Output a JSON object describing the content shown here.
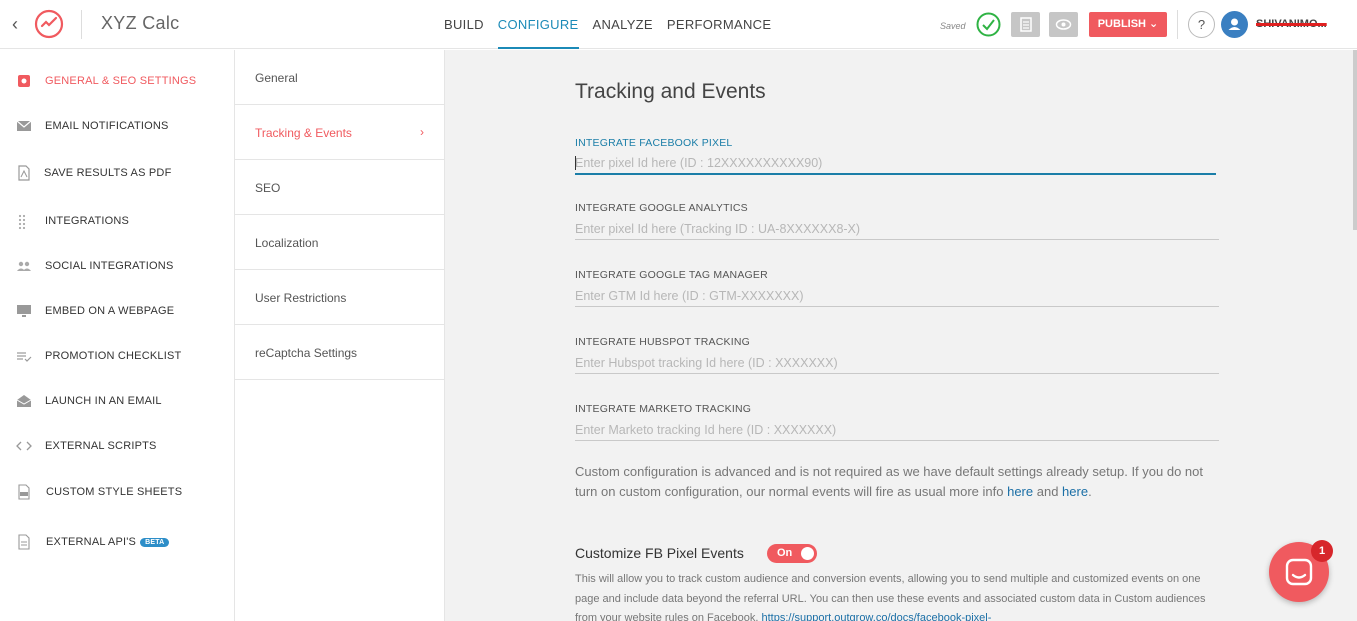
{
  "app": {
    "name": "XYZ Calc"
  },
  "nav": {
    "tabs": [
      {
        "label": "BUILD"
      },
      {
        "label": "CONFIGURE"
      },
      {
        "label": "ANALYZE"
      },
      {
        "label": "PERFORMANCE"
      }
    ],
    "active_tab": "CONFIGURE"
  },
  "toolbar": {
    "saved_label": "Saved",
    "publish_label": "PUBLISH ⌄",
    "help_label": "?",
    "username": "SHIVANIMO..."
  },
  "sidebar": {
    "items": [
      {
        "label": "GENERAL & SEO SETTINGS",
        "icon": "settings-icon",
        "active": true
      },
      {
        "label": "EMAIL NOTIFICATIONS",
        "icon": "envelope-icon"
      },
      {
        "label": "SAVE RESULTS AS PDF",
        "icon": "pdf-icon"
      },
      {
        "label": "INTEGRATIONS",
        "icon": "grid-dots-icon"
      },
      {
        "label": "SOCIAL INTEGRATIONS",
        "icon": "people-icon"
      },
      {
        "label": "EMBED ON A WEBPAGE",
        "icon": "monitor-icon"
      },
      {
        "label": "PROMOTION CHECKLIST",
        "icon": "checklist-icon"
      },
      {
        "label": "LAUNCH IN AN EMAIL",
        "icon": "open-envelope-icon"
      },
      {
        "label": "EXTERNAL SCRIPTS",
        "icon": "code-icon"
      },
      {
        "label": "CUSTOM STYLE SHEETS",
        "icon": "css-file-icon"
      },
      {
        "label": "EXTERNAL API'S",
        "icon": "api-file-icon",
        "badge": "BETA"
      }
    ]
  },
  "submenu": {
    "items": [
      {
        "label": "General"
      },
      {
        "label": "Tracking & Events",
        "active": true
      },
      {
        "label": "SEO"
      },
      {
        "label": "Localization"
      },
      {
        "label": "User Restrictions"
      },
      {
        "label": "reCaptcha Settings"
      }
    ],
    "chevron": "›"
  },
  "main": {
    "title": "Tracking and Events",
    "fields": [
      {
        "label": "INTEGRATE FACEBOOK PIXEL",
        "placeholder": "Enter pixel Id here (ID : 12XXXXXXXXXX90)",
        "value": ""
      },
      {
        "label": "INTEGRATE GOOGLE ANALYTICS",
        "placeholder": "Enter pixel Id here (Tracking ID : UA-8XXXXXX8-X)",
        "value": ""
      },
      {
        "label": "INTEGRATE GOOGLE TAG MANAGER",
        "placeholder": "Enter GTM Id here (ID : GTM-XXXXXXX)",
        "value": ""
      },
      {
        "label": "INTEGRATE HUBSPOT TRACKING",
        "placeholder": "Enter Hubspot tracking Id here (ID : XXXXXXX)",
        "value": ""
      },
      {
        "label": "INTEGRATE MARKETO TRACKING",
        "placeholder": "Enter Marketo tracking Id here (ID : XXXXXXX)",
        "value": ""
      }
    ],
    "custom_config": {
      "text_before": "Custom configuration is advanced and is not required as we have default settings already setup. If you do not turn on custom configuration, our normal events will fire as usual more info ",
      "link1": "here",
      "text_middle": " and ",
      "link2": "here",
      "text_after": "."
    },
    "fb_events": {
      "heading": "Customize FB Pixel Events",
      "toggle_label": "On",
      "description": "This will allow you to track custom audience and conversion events, allowing you to send multiple and customized events on one page and include data beyond the referral URL. You can then use these events and associated custom data in Custom audiences from your website rules on Facebook. ",
      "link": "https://support.outgrow.co/docs/facebook-pixel-"
    }
  },
  "chat": {
    "badge_count": "1"
  },
  "colors": {
    "accent": "#f05a5f",
    "link": "#1b7ea8",
    "background": "#f2f2f2"
  }
}
